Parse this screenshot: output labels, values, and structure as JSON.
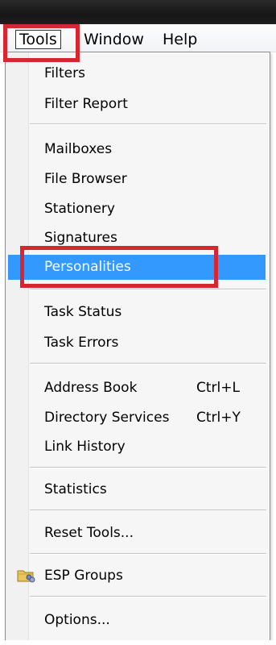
{
  "menubar": {
    "items": [
      {
        "label": "Tools"
      },
      {
        "label": "Window"
      },
      {
        "label": "Help"
      }
    ]
  },
  "dropdown": {
    "items": [
      {
        "label": "Filters"
      },
      {
        "label": "Filter Report"
      },
      {
        "label": "Mailboxes"
      },
      {
        "label": "File Browser"
      },
      {
        "label": "Stationery"
      },
      {
        "label": "Signatures"
      },
      {
        "label": "Personalities"
      },
      {
        "label": "Task Status"
      },
      {
        "label": "Task Errors"
      },
      {
        "label": "Address Book",
        "shortcut": "Ctrl+L"
      },
      {
        "label": "Directory Services",
        "shortcut": "Ctrl+Y"
      },
      {
        "label": "Link History"
      },
      {
        "label": "Statistics"
      },
      {
        "label": "Reset Tools..."
      },
      {
        "label": "ESP Groups",
        "icon": "folder-group-icon"
      },
      {
        "label": "Options..."
      }
    ]
  },
  "colors": {
    "selection": "#3399ff",
    "highlight_box": "#d7262f",
    "menu_background": "#f6f6f6"
  }
}
